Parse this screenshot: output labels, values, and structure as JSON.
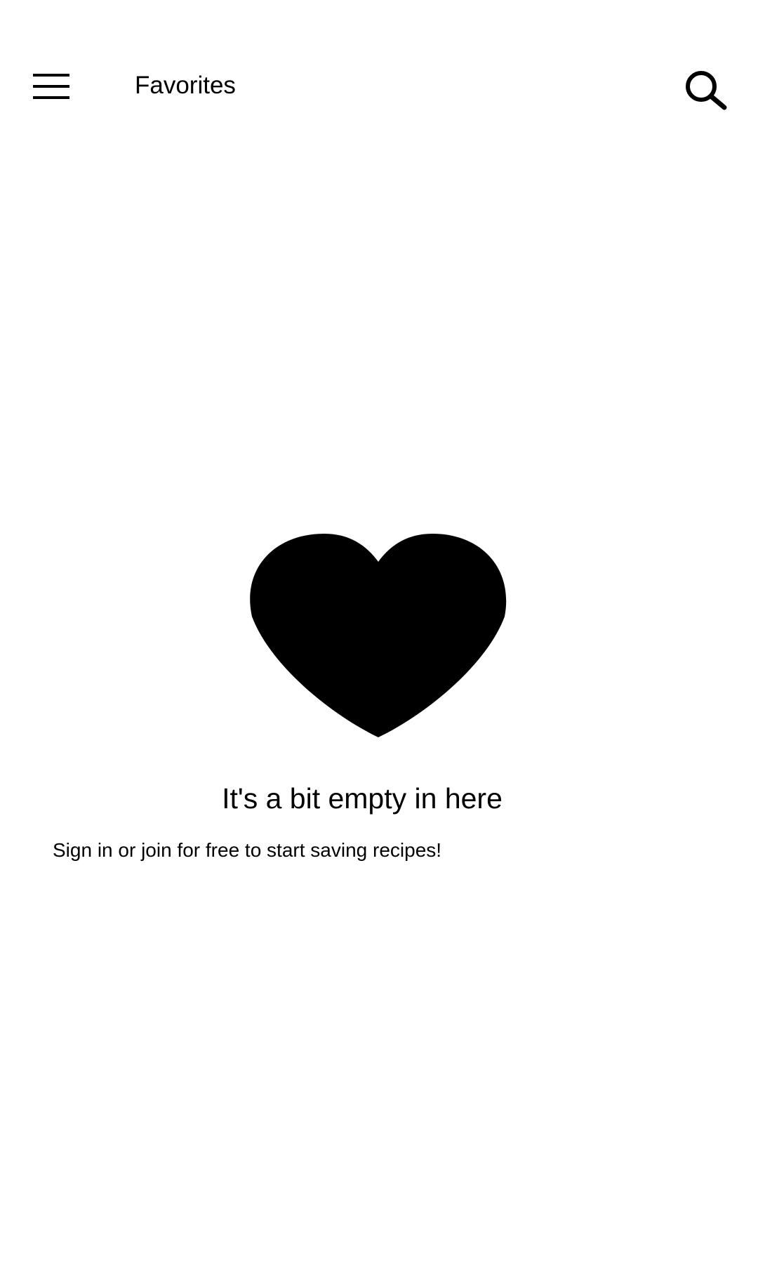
{
  "app_bar": {
    "menu_icon": "hamburger-menu-icon",
    "title": "Favorites",
    "search_icon": "search-icon"
  },
  "empty_state": {
    "icon": "heart-icon",
    "title": "It's a bit empty in here",
    "subtitle": "Sign in or join for free to start saving recipes!"
  },
  "colors": {
    "background": "#ffffff",
    "foreground": "#000000"
  }
}
